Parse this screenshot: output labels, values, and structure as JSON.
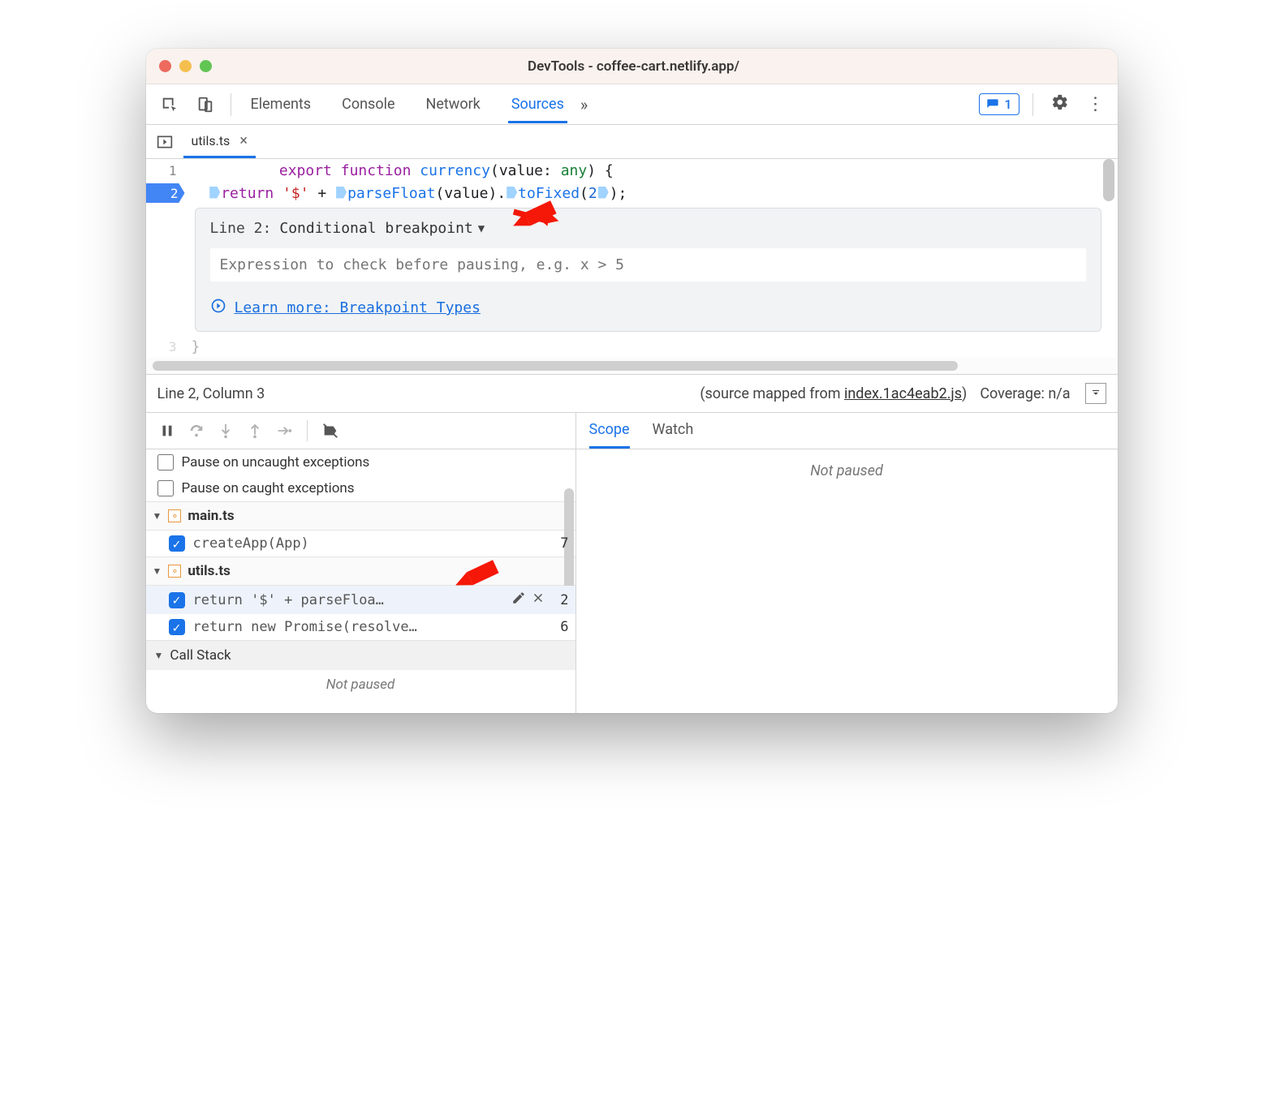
{
  "window": {
    "title": "DevTools - coffee-cart.netlify.app/"
  },
  "tabs": {
    "items": [
      "Elements",
      "Console",
      "Network",
      "Sources"
    ],
    "activeIndex": 3,
    "overflow": "»",
    "issuesCount": "1"
  },
  "fileTabs": {
    "active": "utils.ts"
  },
  "editor": {
    "line1": {
      "num": "1",
      "t0": "export ",
      "t1": "function ",
      "t2": "currency",
      "t3": "(",
      "t4": "value",
      "t5": ": ",
      "t6": "any",
      "t7": ") {"
    },
    "line2": {
      "num": "2",
      "t0": "return ",
      "t1": "'$'",
      "t2": " + ",
      "t3": "parseFloat",
      "t4": "(",
      "t5": "value",
      "t6": ").",
      "t7": "toFixed",
      "t8": "(",
      "t9": "2",
      "t10": ");"
    },
    "line3": {
      "num": "3",
      "t0": "}"
    }
  },
  "breakpointPopup": {
    "lineLabel": "Line 2:",
    "typeLabel": "Conditional breakpoint",
    "placeholder": "Expression to check before pausing, e.g. x > 5",
    "learnMore": "Learn more: Breakpoint Types"
  },
  "statusbar": {
    "pos": "Line 2, Column 3",
    "mappedPrefix": "(source mapped from ",
    "mappedFile": "index.1ac4eab2.js",
    "mappedSuffix": ")",
    "coverage": "Coverage: n/a"
  },
  "debugger": {
    "pauseUncaught": "Pause on uncaught exceptions",
    "pauseCaught": "Pause on caught exceptions",
    "groups": [
      {
        "file": "main.ts",
        "rows": [
          {
            "snippet": "createApp(App)",
            "line": "7"
          }
        ]
      },
      {
        "file": "utils.ts",
        "rows": [
          {
            "snippet": "return '$' + parseFloa…",
            "line": "2",
            "hover": true
          },
          {
            "snippet": "return new Promise(resolve…",
            "line": "6"
          }
        ]
      }
    ],
    "callStackLabel": "Call Stack",
    "notPaused": "Not paused"
  },
  "rightPanel": {
    "tabs": [
      "Scope",
      "Watch"
    ],
    "activeIndex": 0,
    "notPaused": "Not paused"
  }
}
